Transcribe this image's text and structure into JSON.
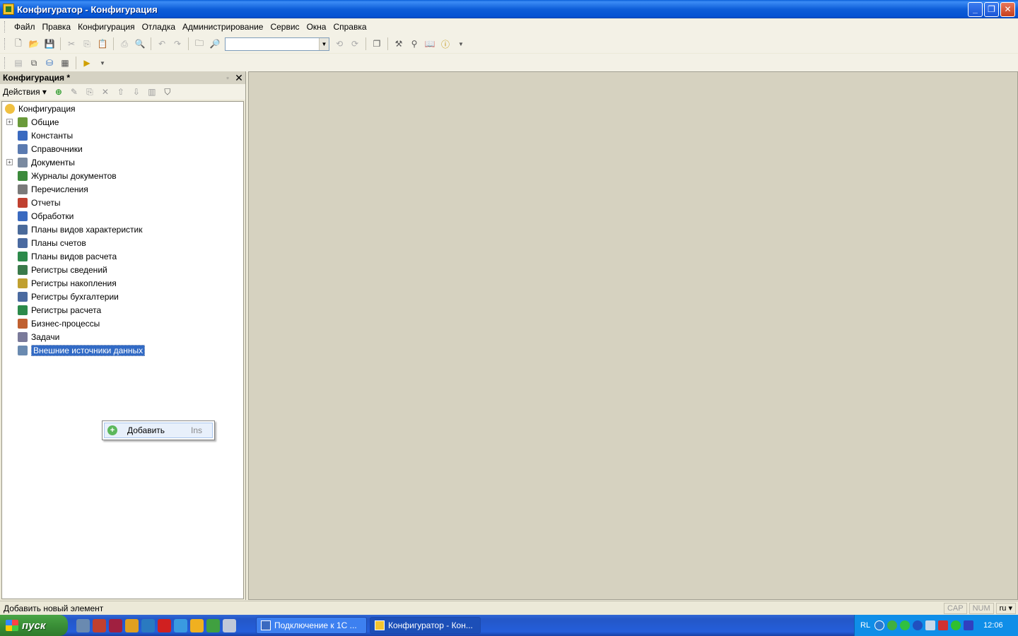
{
  "window": {
    "title": "Конфигуратор - Конфигурация",
    "minimize": "_",
    "restore": "❐",
    "close": "✕"
  },
  "menu": [
    {
      "label": "Файл"
    },
    {
      "label": "Правка"
    },
    {
      "label": "Конфигурация"
    },
    {
      "label": "Отладка"
    },
    {
      "label": "Администрирование"
    },
    {
      "label": "Сервис"
    },
    {
      "label": "Окна"
    },
    {
      "label": "Справка"
    }
  ],
  "search": {
    "value": ""
  },
  "panel": {
    "title": "Конфигурация *",
    "pin": "▫",
    "close": "✕",
    "actions_label": "Действия ▾"
  },
  "tree": {
    "root": "Конфигурация",
    "items": [
      {
        "label": "Общие",
        "expandable": true,
        "color": "#6a9a3a"
      },
      {
        "label": "Константы",
        "expandable": false,
        "color": "#3a6ac0"
      },
      {
        "label": "Справочники",
        "expandable": false,
        "color": "#5a7ab0"
      },
      {
        "label": "Документы",
        "expandable": true,
        "color": "#7a8aa0"
      },
      {
        "label": "Журналы документов",
        "expandable": false,
        "color": "#3c8a3c"
      },
      {
        "label": "Перечисления",
        "expandable": false,
        "color": "#7a7a7a"
      },
      {
        "label": "Отчеты",
        "expandable": false,
        "color": "#c04030"
      },
      {
        "label": "Обработки",
        "expandable": false,
        "color": "#3a6ac0"
      },
      {
        "label": "Планы видов характеристик",
        "expandable": false,
        "color": "#4a6a9a"
      },
      {
        "label": "Планы счетов",
        "expandable": false,
        "color": "#4a6aa0"
      },
      {
        "label": "Планы видов расчета",
        "expandable": false,
        "color": "#2c8a4a"
      },
      {
        "label": "Регистры сведений",
        "expandable": false,
        "color": "#3a7a4a"
      },
      {
        "label": "Регистры накопления",
        "expandable": false,
        "color": "#c0a030"
      },
      {
        "label": "Регистры бухгалтерии",
        "expandable": false,
        "color": "#4a6aa0"
      },
      {
        "label": "Регистры расчета",
        "expandable": false,
        "color": "#2c8a4a"
      },
      {
        "label": "Бизнес-процессы",
        "expandable": false,
        "color": "#c06030"
      },
      {
        "label": "Задачи",
        "expandable": false,
        "color": "#7a7a9a"
      },
      {
        "label": "Внешние источники данных",
        "expandable": false,
        "color": "#6a8ab0",
        "selected": true
      }
    ]
  },
  "context_menu": {
    "add_label": "Добавить",
    "add_shortcut": "Ins"
  },
  "status": {
    "message": "Добавить новый элемент",
    "cap": "CAP",
    "num": "NUM",
    "lang": "ru ▾"
  },
  "taskbar": {
    "start": "пуск",
    "tasks": [
      {
        "label": "Подключение к 1С ..."
      },
      {
        "label": "Конфигуратор - Кон..."
      }
    ],
    "tray_lang": "RL",
    "clock": "12:06"
  },
  "colors": {
    "selection": "#316ac5",
    "workspace": "#d6d2c0",
    "taskbar": "#245edb"
  }
}
